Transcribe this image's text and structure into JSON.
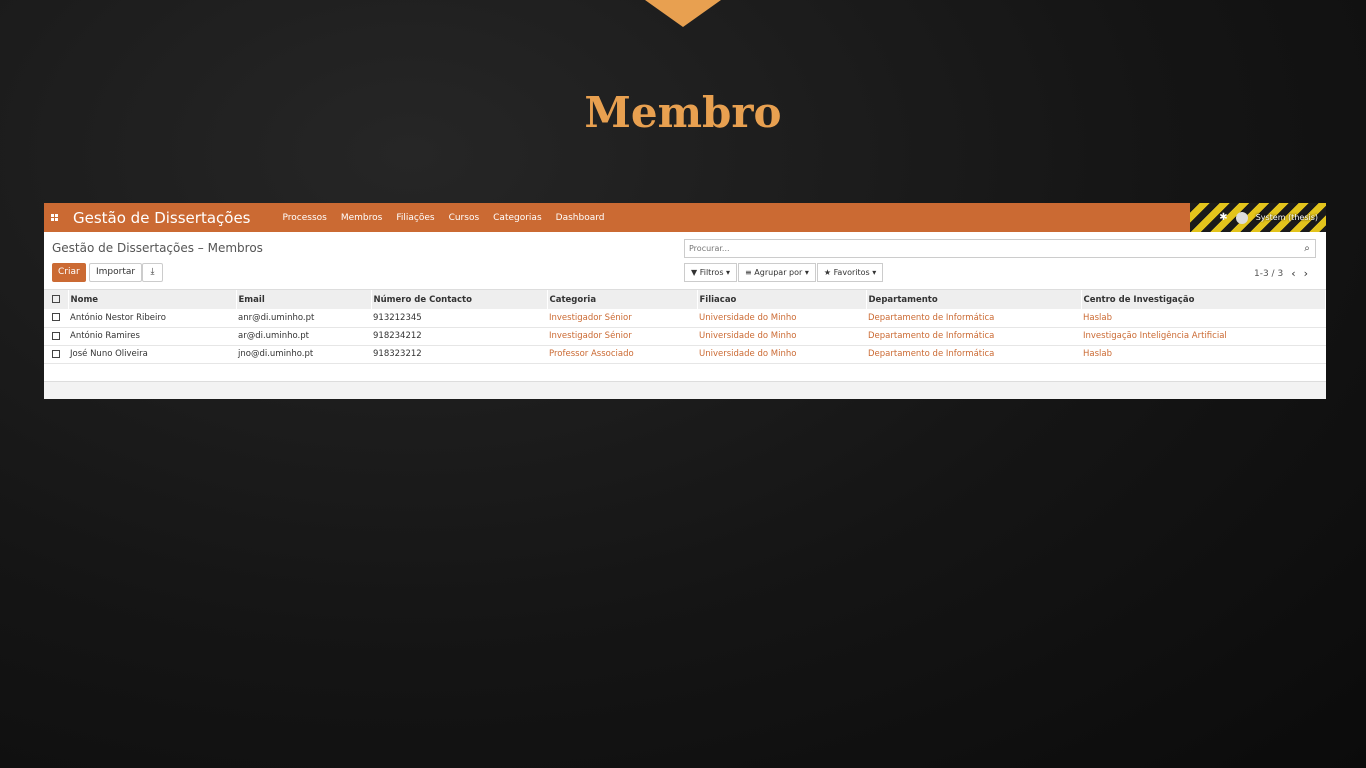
{
  "slide": {
    "title": "Membro"
  },
  "navbar": {
    "brand": "Gestão de Dissertações",
    "menu": [
      "Processos",
      "Membros",
      "Filiações",
      "Cursos",
      "Categorias",
      "Dashboard"
    ],
    "user": "System (thesis)"
  },
  "control": {
    "breadcrumb": "Gestão de Dissertações – Membros",
    "create_label": "Criar",
    "import_label": "Importar",
    "search_placeholder": "Procurar...",
    "filters_label": "Filtros",
    "groupby_label": "Agrupar por",
    "favorites_label": "Favoritos",
    "pager": "1-3 / 3"
  },
  "table": {
    "headers": [
      "Nome",
      "Email",
      "Número de Contacto",
      "Categoria",
      "Filiacao",
      "Departamento",
      "Centro de Investigação"
    ],
    "rows": [
      [
        "António Nestor Ribeiro",
        "anr@di.uminho.pt",
        "913212345",
        "Investigador Sénior",
        "Universidade do Minho",
        "Departamento de Informática",
        "Haslab"
      ],
      [
        "António Ramires",
        "ar@di.uminho.pt",
        "918234212",
        "Investigador Sénior",
        "Universidade do Minho",
        "Departamento de Informática",
        "Investigação Inteligência Artificial"
      ],
      [
        "José Nuno Oliveira",
        "jno@di.uminho.pt",
        "918323212",
        "Professor Associado",
        "Universidade do Minho",
        "Departamento de Informática",
        "Haslab"
      ]
    ]
  },
  "colors": {
    "accent": "#cb6a33",
    "title": "#e8a050"
  }
}
